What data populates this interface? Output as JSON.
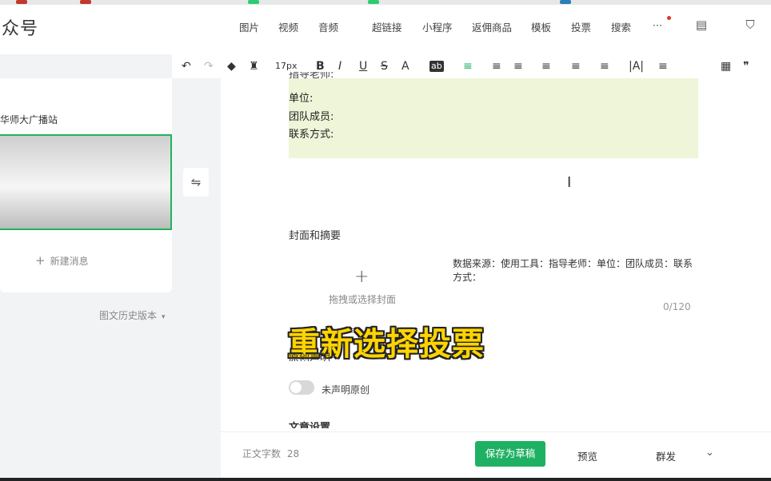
{
  "header": {
    "brand": "众号",
    "nav": [
      "图片",
      "视频",
      "音频",
      "超链接",
      "小程序",
      "返佣商品",
      "模板",
      "投票",
      "搜索",
      "···"
    ]
  },
  "toolbar": {
    "font_size": "17px",
    "buttons": [
      "↶",
      "↷",
      "◆",
      "♜",
      "B",
      "I",
      "U",
      "S",
      "A",
      "ab",
      "≡",
      "≡",
      "≡",
      "≡",
      "≡",
      "≡",
      "|A|",
      "≡",
      "▦",
      "❞"
    ]
  },
  "sidebar": {
    "account_title": "华师大广播站",
    "new_message": "新建消息",
    "history": "图文历史版本"
  },
  "editor": {
    "partial_top": "指导老师:",
    "fields": [
      "单位:",
      "团队成员:",
      "联系方式:"
    ],
    "cover_section": "封面和摘要",
    "cover_hint": "拖拽或选择封面",
    "abstract": "数据来源：使用工具：指导老师：单位：团队成员：联系方式：",
    "abstract_counter": "0/120",
    "original_section": "原创声明",
    "original_toggle_label": "未声明原创",
    "article_settings": "文章设置"
  },
  "overlay_caption": "重新选择投票",
  "bottom": {
    "wordcount_label": "正文字数",
    "wordcount_value": "28",
    "save_draft": "保存为草稿",
    "preview": "预览",
    "publish": "群发"
  },
  "colors": {
    "primary_green": "#1fb163",
    "highlight_bg": "#eef5d8",
    "caption_yellow": "#ffd400"
  }
}
